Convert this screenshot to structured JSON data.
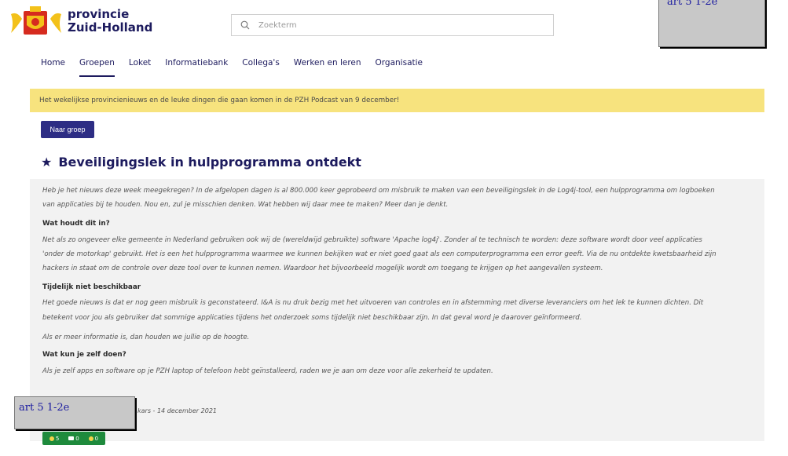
{
  "header": {
    "brand_line1": "provincie",
    "brand_line2": "Zuid-Holland",
    "search_placeholder": "Zoekterm",
    "search_icon": "search-icon",
    "logo_icon": "coat-of-arms-logo"
  },
  "redactions": {
    "top_right": "art 5 1-2e",
    "bottom_left": "art 5 1-2e"
  },
  "nav": {
    "items": [
      "Home",
      "Groepen",
      "Loket",
      "Informatiebank",
      "Collega's",
      "Werken en leren",
      "Organisatie"
    ],
    "active": "Groepen"
  },
  "banner": {
    "text": "Het wekelijkse provincienieuws en de leuke dingen die gaan komen in de PZH Podcast van 9 december!"
  },
  "group_button": {
    "label": "Naar groep"
  },
  "article": {
    "title": "Beveiligingslek in hulpprogramma ontdekt",
    "intro_line1": "Heb je het nieuws deze week meegekregen? In de afgelopen dagen is al 800.000 keer geprobeerd om misbruik te maken van een beveiligingslek in de Log4j-tool, een hulpprogramma om logboeken",
    "intro_line2": "van applicaties bij te houden. Nou en, zul je misschien denken. Wat hebben wij daar mee te maken? Meer dan je denkt.",
    "h1": "Wat houdt dit in?",
    "p1_line1": "Net als zo ongeveer elke gemeente in Nederland gebruiken ook wij de (wereldwijd gebruikte) software 'Apache log4j'. Zonder al te technisch te worden: deze software wordt door veel applicaties",
    "p1_line2": "'onder de motorkap' gebruikt. Het is een het hulpprogramma waarmee we kunnen bekijken wat er niet goed gaat als een computerprogramma een error geeft. Via de nu ontdekte kwetsbaarheid zijn",
    "p1_line3": "hackers in staat om de controle over deze tool over te kunnen nemen. Waardoor het bijvoorbeeld mogelijk wordt om toegang te krijgen op het aangevallen systeem.",
    "h2": "Tijdelijk niet beschikbaar",
    "p2_line1": "Het goede nieuws is dat er nog geen misbruik is geconstateerd. I&A is nu druk bezig met het uitvoeren van controles en in afstemming met diverse leveranciers om het lek te kunnen dichten. Dit",
    "p2_line2": "betekent voor jou als gebruiker dat sommige applicaties tijdens het onderzoek soms tijdelijk niet beschikbaar zijn.  In dat geval word je daarover geïnformeerd.",
    "p3": "Als er meer informatie is, dan houden we jullie op de hoogte.",
    "h3": "Wat kun je zelf doen?",
    "p4": "Als je zelf apps en software op je PZH laptop of telefoon hebt geïnstalleerd, raden we je aan om deze voor alle zekerheid te updaten.",
    "byline": "kars - 14 december 2021"
  },
  "reactions": [
    {
      "icon": "views-icon",
      "count": "5",
      "color": "#f2d24b"
    },
    {
      "icon": "comment-icon",
      "count": "0",
      "color": "#ffffff"
    },
    {
      "icon": "like-icon",
      "count": "0",
      "color": "#f2d24b"
    }
  ],
  "colors": {
    "brand_navy": "#1d1b5e",
    "button": "#2d2d84",
    "banner": "#f7e37e",
    "reaction_bar": "#1e8a3c"
  }
}
